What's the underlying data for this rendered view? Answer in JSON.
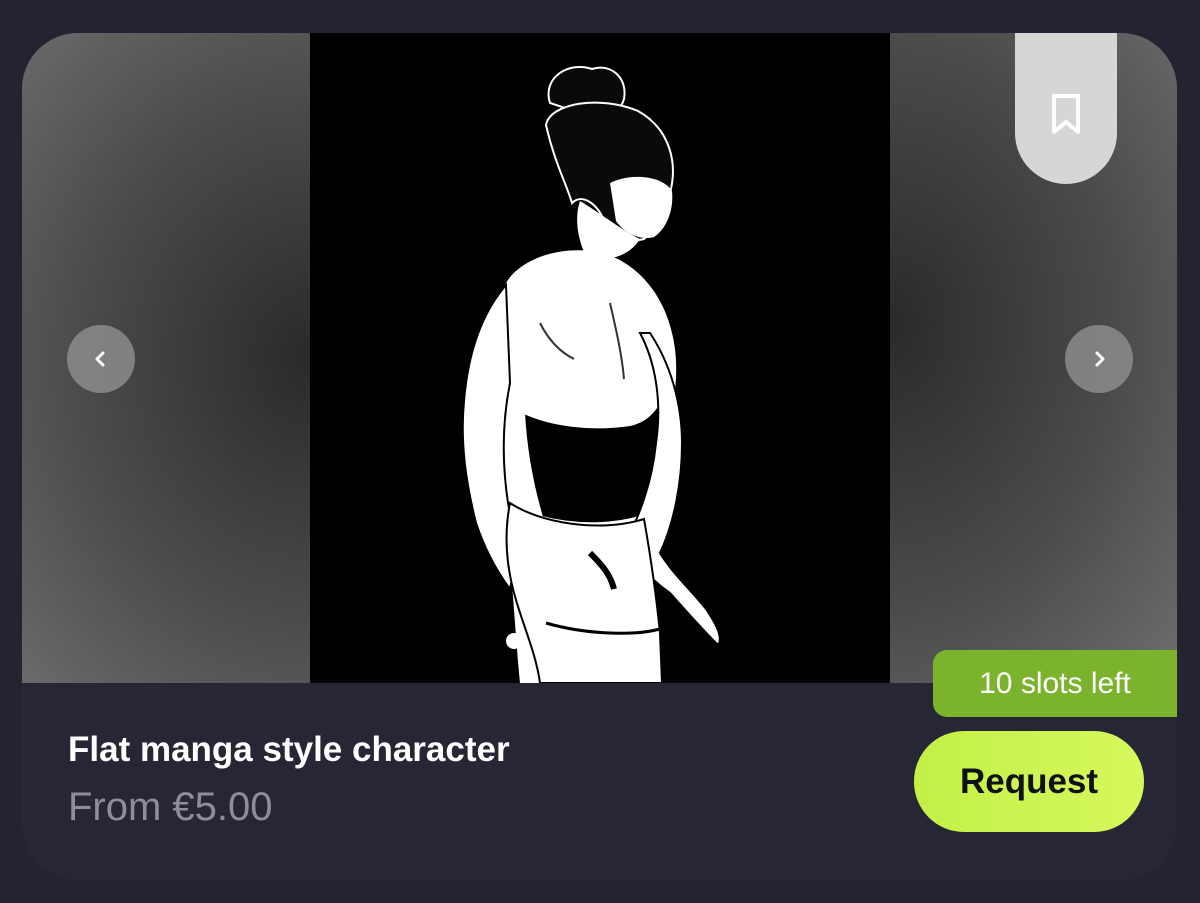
{
  "listing": {
    "title": "Flat manga style character",
    "price": "From €5.00",
    "slots_badge": "10 slots left",
    "request_label": "Request"
  },
  "gallery": {
    "active_index": 0,
    "icons": {
      "prev": "chevron-left-icon",
      "next": "chevron-right-icon",
      "bookmark": "bookmark-icon"
    }
  },
  "colors": {
    "page_background": "#232331",
    "card_background": "#262635",
    "badge_green": "#7cb32c",
    "request_button": "#c8f24c",
    "price_text": "#8e8e98"
  }
}
